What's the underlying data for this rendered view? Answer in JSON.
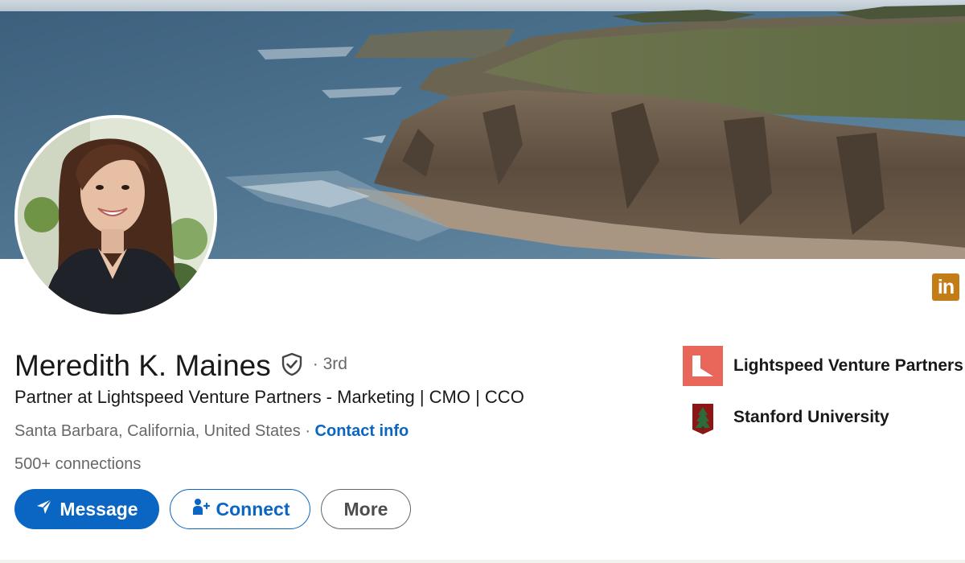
{
  "profile": {
    "name": "Meredith K. Maines",
    "degree": "· 3rd",
    "headline": "Partner at Lightspeed Venture Partners - Marketing | CMO | CCO",
    "location": "Santa Barbara, California, United States",
    "location_separator": " · ",
    "contact_info": "Contact info",
    "connections": "500+ connections"
  },
  "actions": {
    "message": "Message",
    "connect": "Connect",
    "more": "More"
  },
  "orgs": [
    {
      "name": "Lightspeed Venture Partners",
      "icon": "lightspeed-logo"
    },
    {
      "name": "Stanford University",
      "icon": "stanford-logo"
    }
  ],
  "brand": {
    "badge_text": "in",
    "badge_color": "#c37d16"
  },
  "colors": {
    "primary": "#0a66c2",
    "lightspeed": "#e8675a",
    "stanford": "#8c1515"
  },
  "icons": {
    "verified": "shield-check-icon",
    "message": "send-icon",
    "connect": "add-person-icon"
  }
}
